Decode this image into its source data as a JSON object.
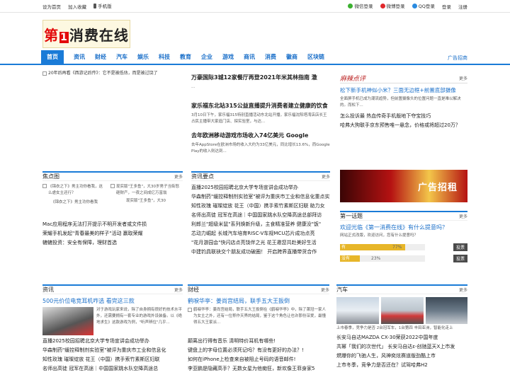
{
  "topbar": {
    "left": [
      "设为首页",
      "加入收藏",
      "手机版"
    ],
    "right": [
      "微信登录",
      "微博登录",
      "QQ登录",
      "登录",
      "注册"
    ]
  },
  "logo": {
    "prefix": "第",
    "num": "1",
    "name": "消费在线"
  },
  "nav": {
    "items": [
      "首页",
      "资讯",
      "财经",
      "汽车",
      "娱乐",
      "科技",
      "教育",
      "企业",
      "游戏",
      "商讯",
      "消费",
      "徽商",
      "区块链"
    ],
    "ad": "广告招商"
  },
  "hero": {
    "caption": "20年后再看《西游记后传》：它不是被低估，而是被过饶了"
  },
  "headlines": [
    {
      "title": "万豪国际3城12家餐厅再登2021年米其林指南 潵",
      "sub": "..."
    },
    {
      "title": "家乐福东北站315公益直播提升消费者建立健康的饮食",
      "sub": "3月10日下午，家乐福315特别直播活动东北站开播，家乐福沈阳塔湾店店长王占民主播带大家逛门店、探实验室，与达..."
    },
    {
      "title": "去年欧洲移动游戏市场收入74亿美元 Google",
      "sub": "去年AppStore在欧洲市场的收入大约为33亿美元，同比增长13.6%，而Google Play的收入则达到..."
    }
  ],
  "review": {
    "title": "麻辣点评",
    "more": "更多",
    "lead": "松下新手机神似小米？三面无边框+前置底部摄像",
    "lead_sub": "全面屏手机已成为潮流趋势，但前置摄像头的位置问题一直是难以解决的。而松下...",
    "items": [
      "怎么投诉最 热血传奇手机版地下夺宝技巧",
      "哈弗大狗联手京东预售唯一悬念，价格或将超过20万？"
    ]
  },
  "focus": {
    "title": "焦点图",
    "more": "更多",
    "items": [
      "《锦衣之下》男主功你看我，这么虐女主还行？",
      "《锦衣之下》男主功你看我",
      "现实版\"王多鱼\"，大30岁男子当街怒砸财产，一夜之间成亿万富翁",
      "现实版\"王多鱼\"，大30"
    ],
    "links": [
      "Mac应用程序无法打开提示不明开发者或文件损",
      "荣耀手机发起\"青春最美的样子\"活动 赢取荣耀",
      "辘辘投资：安全有保障，理财首选"
    ]
  },
  "info": {
    "title": "资讯要点",
    "more": "更多",
    "items": [
      "直播2025校园招聘北京大学专场宣讲会成功举办",
      "华森制药\"缓控释制剂实验室\"被评为重庆市工业和信息化重点实",
      "知性玫瑰 璀璨绽放 花王（中国）携手索竹素斯区妇联 助力女",
      "名师出高徒 冠军在高途｜中国国家跳水队空降高途总部拜访",
      "利郎兰\"超级米鼠\"系列焕新升级，主食精准营养 健康没\"饭\"",
      "芯动力崛起 长城汽车培育RISC-V车规MCU芯片成功点亮",
      "\"花月游园会\"快闪店点亮饶伴之光 花王邀您共赴美好生活",
      "中建钓具联袂交个朋友成功破圈！ 开启跨界直播带货合作"
    ]
  },
  "ad": {
    "text": "广告招租"
  },
  "poll": {
    "title": "第一话题",
    "more": "更多",
    "question": "欢迎光临《第一消费在线》有什么提意吗？",
    "hint": "网站正式改版，欢迎访问，您有什么提意吗？",
    "yes_label": "有",
    "yes_pct": "77%",
    "yes_val": 0.77,
    "no_label": "没有",
    "no_pct": "23%",
    "no_val": 0.23,
    "vote": "投票",
    "vote2": "投票"
  },
  "news": {
    "title": "资讯",
    "more": "更多",
    "lead": "500元价位电竞耳机咋选 看完这三款",
    "lead_sub": "对于游戏玩家来说，除了自身拥有很好的技术水平外，还需要拥有一套专业的游戏外设装备。以《绝地求生》这款游戏为例，\"听声辨位\"几乎...",
    "items": [
      "直播2025校园招聘北京大学专场宣讲会成功举办",
      "华森制药\"缓控释制剂实验室\"被评为重庆市工业和信息化",
      "知性玫瑰 璀璨绽放 花王（中国）携手索竹素斯区妇联",
      "名师出高徒 冠军在高途｜中国国家跳水队空降高途总"
    ]
  },
  "finance": {
    "title": "财经",
    "more": "更多",
    "lead": "鹤唳华亭：姜尚宫结局，联手五大王扳倒",
    "lead_sub": "鹤唳华亭：姜尚宫结局，联手五大王扳倒在《鹤唳华亭》中，除了萧冠一家人为女主之外，还有一位称作天界的结局，鉴于这个角色让也许那份深爱，最懂得五大王家派...",
    "items": [
      "颠离出行得有音乐 清明特价耳机有哪些!",
      "键盘上的字母位置必须死记吗？有没有更好的办法？!",
      "如何在iPhone上检查来自被阻止号码的语音邮件!",
      "李亚鹏是隐藏高手？无数女星为他痴狂，新欢像王菲身家5"
    ]
  },
  "auto": {
    "title": "汽车",
    "more": "更多",
    "caption": "上市春季，竞争力是否  2台冠军车，1台第四  丰田亚洲，智能化走上",
    "items": [
      "长安马自达MAZDA CX-30荣获2022中国年度",
      "共幂「我们的次世代」 长安马自达ε-创驰蓝天X上市发",
      "燃爆你的飞驰人生，风神奕炫赛道版劲酷上市",
      "上市冬季，竞争力是否还在？试驾哈弗H2"
    ]
  }
}
